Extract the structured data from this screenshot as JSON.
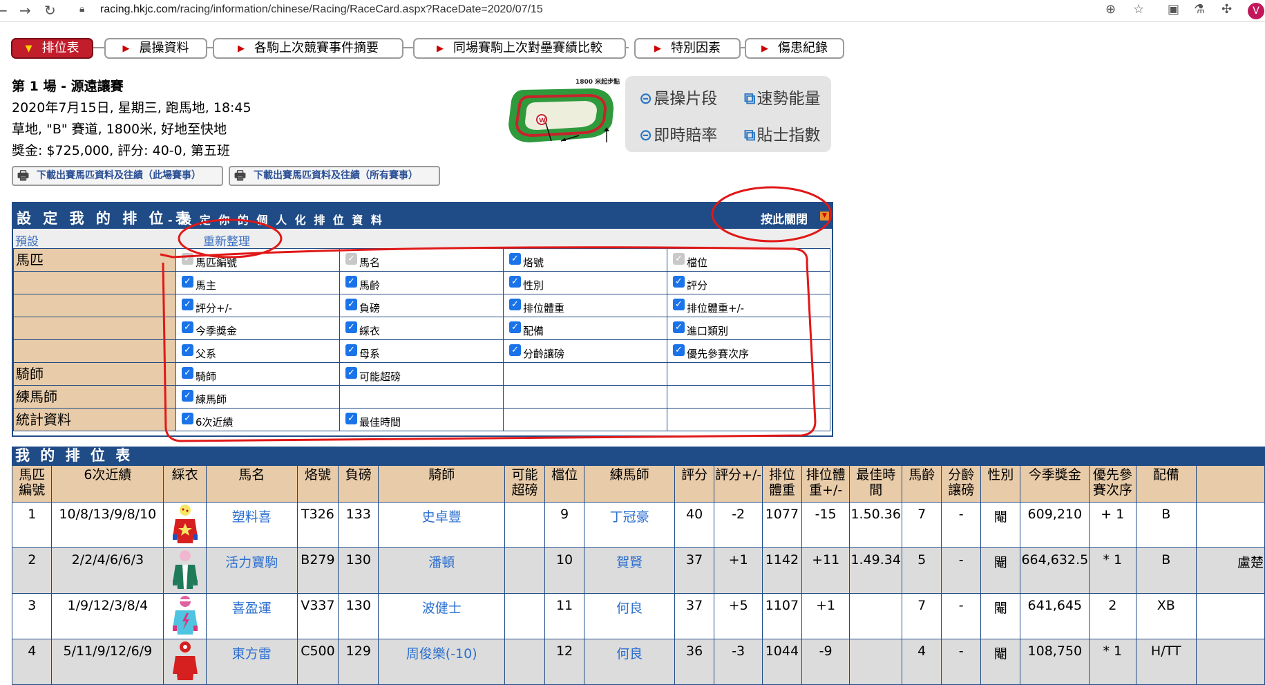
{
  "browser": {
    "url_host": "racing.hkjc.com",
    "url_path": "/racing/information/chinese/Racing/RaceCard.aspx?RaceDate=2020/07/15",
    "avatar_letter": "V"
  },
  "tabs": [
    {
      "label": "排位表",
      "active": true
    },
    {
      "label": "晨操資料"
    },
    {
      "label": "各駒上次競賽事件摘要"
    },
    {
      "label": "同場賽駒上次對壘賽績比較"
    },
    {
      "label": "特別因素"
    },
    {
      "label": "傷患紀錄"
    }
  ],
  "race": {
    "title": "第 1 場 - 源遠讓賽",
    "line1": "2020年7月15日, 星期三, 跑馬地, 18:45",
    "line2": "草地, \"B\" 賽道, 1800米, 好地至快地",
    "line3": "獎金: $725,000, 評分: 40-0, 第五班"
  },
  "print_buttons": {
    "this_race": "下載出賽馬匹資料及往績（此場賽事）",
    "all_races": "下載出賽馬匹資料及往績（所有賽事）"
  },
  "track": {
    "start_label": "1800 米起步點",
    "marker": "W"
  },
  "quick_links": {
    "trackwork": "晨操片段",
    "speedpro": "速勢能量",
    "odds": "即時賠率",
    "tips": "貼士指數"
  },
  "settings": {
    "title": "設 定 我 的 排 位 表",
    "subtitle": "- 設 定 你 的 個 人 化 排 位 資 料",
    "close_label": "按此關閉",
    "default_link": "預設",
    "reset_link": "重新整理",
    "categories": {
      "horse": "馬匹",
      "jockey": "騎師",
      "trainer": "練馬師",
      "stats": "統計資料"
    },
    "options": {
      "horse_no": "馬匹編號",
      "horse_name": "馬名",
      "brand_no": "烙號",
      "draw": "檔位",
      "owner": "馬主",
      "age": "馬齡",
      "sex": "性別",
      "rating": "評分",
      "rating_change": "評分+/-",
      "weight": "負磅",
      "declared_wt": "排位體重",
      "declared_wt_change": "排位體重+/-",
      "season_stakes": "今季獎金",
      "colours": "綵衣",
      "gear": "配備",
      "import_cat": "進口類別",
      "sire": "父系",
      "dam": "母系",
      "wfa": "分齡讓磅",
      "priority": "優先參賽次序",
      "jockey": "騎師",
      "over_wt": "可能超磅",
      "trainer": "練馬師",
      "last6": "6次近績",
      "best_time": "最佳時間"
    }
  },
  "racecard": {
    "title": "我 的 排 位 表",
    "headers": {
      "no": "馬匹編號",
      "last6": "6次近績",
      "colours": "綵衣",
      "name": "馬名",
      "brand": "烙號",
      "wt": "負磅",
      "jockey": "騎師",
      "over": "可能超磅",
      "draw": "檔位",
      "trainer": "練馬師",
      "rtg": "評分",
      "rtg_chg": "評分+/-",
      "dwt": "排位體重",
      "dwt_chg": "排位體重+/-",
      "best": "最佳時間",
      "age": "馬齡",
      "wfa": "分齡讓磅",
      "sex": "性別",
      "stakes": "今季獎金",
      "priority": "優先參賽次序",
      "gear": "配備"
    },
    "rows": [
      {
        "no": "1",
        "last6": "10/8/13/9/8/10",
        "name": "塑料喜",
        "brand": "T326",
        "wt": "133",
        "jockey": "史卓豐",
        "over": "",
        "draw": "9",
        "trainer": "丁冠豪",
        "rtg": "40",
        "rtg_chg": "-2",
        "dwt": "1077",
        "dwt_chg": "-15",
        "best": "1.50.36",
        "age": "7",
        "wfa": "-",
        "sex": "閹",
        "stakes": "609,210",
        "priority": "+ 1",
        "gear": "B",
        "extra": ""
      },
      {
        "no": "2",
        "last6": "2/2/4/6/6/3",
        "name": "活力寶駒",
        "brand": "B279",
        "wt": "130",
        "jockey": "潘頓",
        "over": "",
        "draw": "10",
        "trainer": "賀賢",
        "rtg": "37",
        "rtg_chg": "+1",
        "dwt": "1142",
        "dwt_chg": "+11",
        "best": "1.49.34",
        "age": "5",
        "wfa": "-",
        "sex": "閹",
        "stakes": "664,632.5",
        "priority": "* 1",
        "gear": "B",
        "extra": "盧楚"
      },
      {
        "no": "3",
        "last6": "1/9/12/3/8/4",
        "name": "喜盈運",
        "brand": "V337",
        "wt": "130",
        "jockey": "波健士",
        "over": "",
        "draw": "11",
        "trainer": "何良",
        "rtg": "37",
        "rtg_chg": "+5",
        "dwt": "1107",
        "dwt_chg": "+1",
        "best": "",
        "age": "7",
        "wfa": "-",
        "sex": "閹",
        "stakes": "641,645",
        "priority": "2",
        "gear": "XB",
        "extra": ""
      },
      {
        "no": "4",
        "last6": "5/11/9/12/6/9",
        "name": "東方雷",
        "brand": "C500",
        "wt": "129",
        "jockey": "周俊樂(-10)",
        "over": "",
        "draw": "12",
        "trainer": "何良",
        "rtg": "36",
        "rtg_chg": "-3",
        "dwt": "1044",
        "dwt_chg": "-9",
        "best": "",
        "age": "4",
        "wfa": "-",
        "sex": "閹",
        "stakes": "108,750",
        "priority": "* 1",
        "gear": "H/TT",
        "extra": ""
      }
    ]
  }
}
